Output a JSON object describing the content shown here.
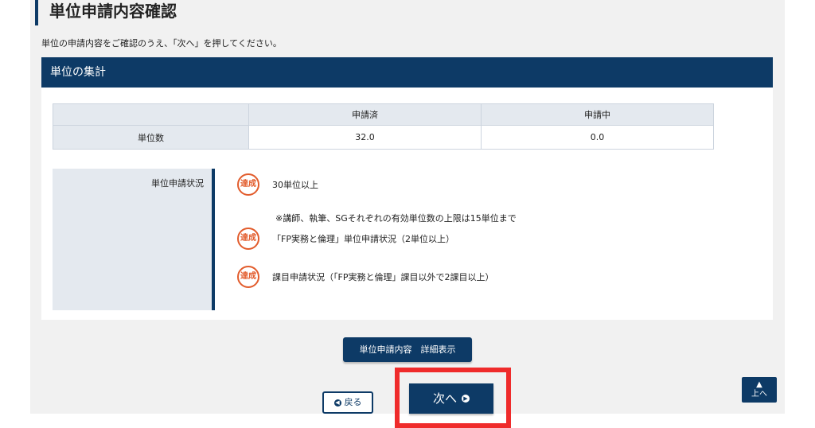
{
  "page": {
    "title": "単位申請内容確認",
    "intro": "単位の申請内容をご確認のうえ、「次へ」を押してください。"
  },
  "summary": {
    "header": "単位の集計",
    "columns": [
      "",
      "申請済",
      "申請中"
    ],
    "row_label": "単位数",
    "values": [
      "32.0",
      "0.0"
    ]
  },
  "status": {
    "label": "単位申請状況",
    "items": [
      {
        "stamp": "達成",
        "text": "30単位以上",
        "note": "※講師、執筆、SGそれぞれの有効単位数の上限は15単位まで"
      },
      {
        "stamp": "達成",
        "text": "「FP実務と倫理」単位申請状況（2単位以上）"
      },
      {
        "stamp": "達成",
        "text": "課目申請状況（「FP実務と倫理」課目以外で2課目以上）"
      }
    ]
  },
  "buttons": {
    "detail": "単位申請内容　詳細表示",
    "back": "戻る",
    "next": "次へ",
    "top": "上へ"
  },
  "icons": {
    "back": "chevron-left-circle-icon",
    "next": "chevron-right-circle-icon",
    "top": "triangle-up-icon",
    "stamp": "achieved-stamp-icon"
  },
  "colors": {
    "navy": "#0d3a66",
    "stamp": "#e25c2c",
    "highlight": "#ef2b2b"
  }
}
